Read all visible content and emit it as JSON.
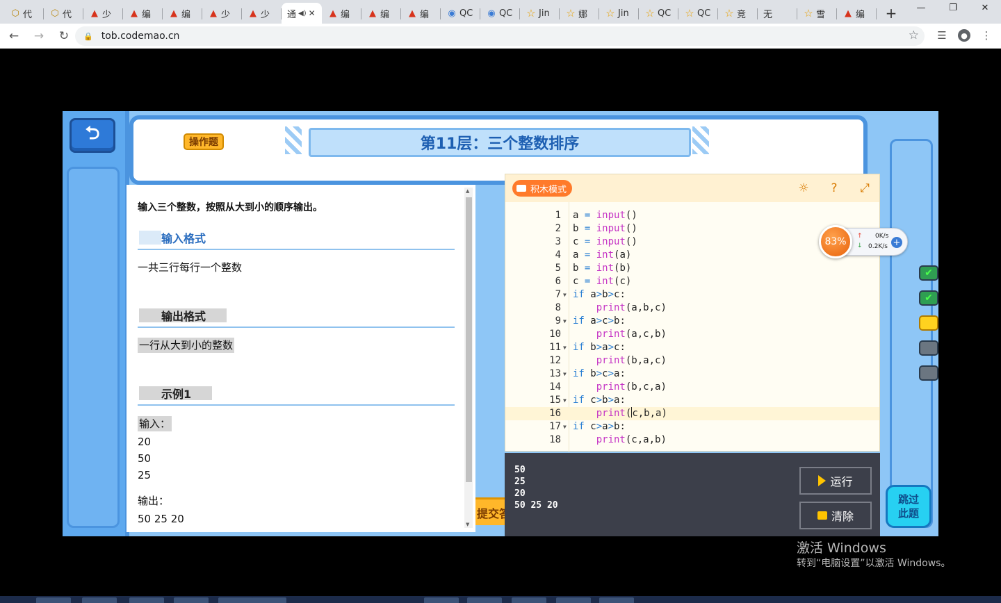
{
  "browser": {
    "tabs": [
      {
        "icon": "cube-icon",
        "label": "代"
      },
      {
        "icon": "cube-icon",
        "label": "代"
      },
      {
        "icon": "codemao-icon",
        "label": "少"
      },
      {
        "icon": "codemao-icon",
        "label": "编"
      },
      {
        "icon": "codemao-icon",
        "label": "编"
      },
      {
        "icon": "codemao-icon",
        "label": "少"
      },
      {
        "icon": "codemao-icon",
        "label": "少"
      },
      {
        "icon": "none",
        "label": "通",
        "active": true
      },
      {
        "icon": "codemao-icon",
        "label": "编"
      },
      {
        "icon": "codemao-icon",
        "label": "编"
      },
      {
        "icon": "codemao-icon",
        "label": "编"
      },
      {
        "icon": "qc-icon",
        "label": "QC"
      },
      {
        "icon": "qc-icon",
        "label": "QC"
      },
      {
        "icon": "star-icon",
        "label": "Jin"
      },
      {
        "icon": "star-icon",
        "label": "娜"
      },
      {
        "icon": "star-icon",
        "label": "Jin"
      },
      {
        "icon": "star-icon",
        "label": "QC"
      },
      {
        "icon": "star-icon",
        "label": "QC"
      },
      {
        "icon": "star-icon",
        "label": "竞"
      },
      {
        "icon": "none",
        "label": "无"
      },
      {
        "icon": "star-icon",
        "label": "雪"
      },
      {
        "icon": "codemao-icon",
        "label": "编"
      }
    ],
    "url": "tob.codemao.cn"
  },
  "level": {
    "tag": "操作题",
    "title": "第11层：三个整数排序"
  },
  "problem": {
    "lead": "输入三个整数，按照从大到小的顺序输出。",
    "input_format_title": "输入格式",
    "input_format_text": "一共三行每行一个整数",
    "output_format_title": "输出格式",
    "output_format_text": "一行从大到小的整数",
    "example_title": "示例1",
    "example_input_label": "输入：",
    "example_input_lines": [
      "20",
      "50",
      "25"
    ],
    "example_output_label": "输出：",
    "example_output": "50 25 20",
    "submit_label": "提交答案"
  },
  "editor": {
    "mode_label": "积木模式",
    "current_line": 16,
    "lines": [
      {
        "n": "1",
        "fold": false,
        "code": "a = input()"
      },
      {
        "n": "2",
        "fold": false,
        "code": "b = input()"
      },
      {
        "n": "3",
        "fold": false,
        "code": "c = input()"
      },
      {
        "n": "4",
        "fold": false,
        "code": "a = int(a)"
      },
      {
        "n": "5",
        "fold": false,
        "code": "b = int(b)"
      },
      {
        "n": "6",
        "fold": false,
        "code": "c = int(c)"
      },
      {
        "n": "7",
        "fold": true,
        "code": "if a>b>c:"
      },
      {
        "n": "8",
        "fold": false,
        "code": "    print(a,b,c)"
      },
      {
        "n": "9",
        "fold": true,
        "code": "if a>c>b:"
      },
      {
        "n": "10",
        "fold": false,
        "code": "    print(a,c,b)"
      },
      {
        "n": "11",
        "fold": true,
        "code": "if b>a>c:"
      },
      {
        "n": "12",
        "fold": false,
        "code": "    print(b,a,c)"
      },
      {
        "n": "13",
        "fold": true,
        "code": "if b>c>a:"
      },
      {
        "n": "14",
        "fold": false,
        "code": "    print(b,c,a)"
      },
      {
        "n": "15",
        "fold": true,
        "code": "if c>b>a:"
      },
      {
        "n": "16",
        "fold": false,
        "code": "    print(c,b,a)"
      },
      {
        "n": "17",
        "fold": true,
        "code": "if c>a>b:"
      },
      {
        "n": "18",
        "fold": false,
        "code": "    print(c,a,b)"
      }
    ]
  },
  "console": {
    "output_lines": [
      "50",
      "25",
      "20",
      "50 25 20"
    ],
    "run_label": "运行",
    "clear_label": "清除"
  },
  "skip_label": "跳过此题",
  "progress": {
    "levels": [
      "done",
      "done",
      "current",
      "locked",
      "locked"
    ]
  },
  "speed_widget": {
    "percent": "83%",
    "upload": "0K/s",
    "download": "0.2K/s"
  },
  "watermark": {
    "line1": "激活 Windows",
    "line2": "转到“电脑设置”以激活 Windows。"
  }
}
